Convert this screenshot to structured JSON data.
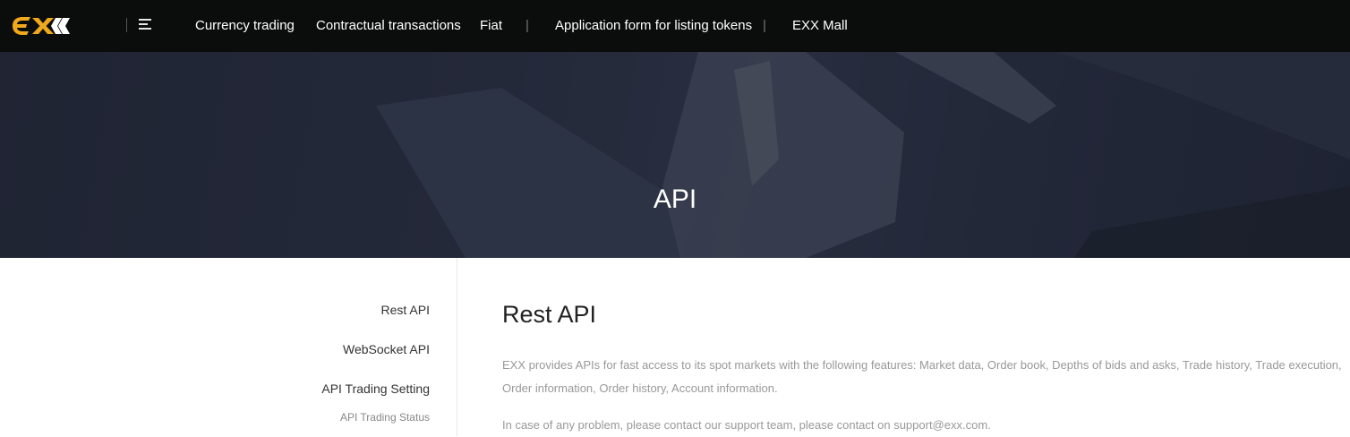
{
  "header": {
    "logo_text": "EXX",
    "nav": [
      {
        "label": "Currency trading"
      },
      {
        "label": "Contractual transactions"
      },
      {
        "label": "Fiat"
      },
      {
        "label": "Application form for listing tokens"
      },
      {
        "label": "EXX Mall"
      }
    ],
    "separator": "|"
  },
  "hero": {
    "title": "API"
  },
  "sidebar": {
    "items": [
      {
        "label": "Rest API"
      },
      {
        "label": "WebSocket API"
      },
      {
        "label": "API Trading Setting"
      },
      {
        "label": "API Trading Status"
      }
    ]
  },
  "main": {
    "title": "Rest API",
    "paragraph1": "EXX provides APIs for fast access to its spot markets with the following features: Market data, Order book, Depths of bids and asks, Trade history, Trade execution, Order information, Order history, Account information.",
    "paragraph2": "In case of any problem, please contact our support team, please contact on support@exx.com."
  },
  "colors": {
    "topbar": "#0b0d0c",
    "logo_accent": "#f0a81c",
    "hero": "#252a3a"
  }
}
